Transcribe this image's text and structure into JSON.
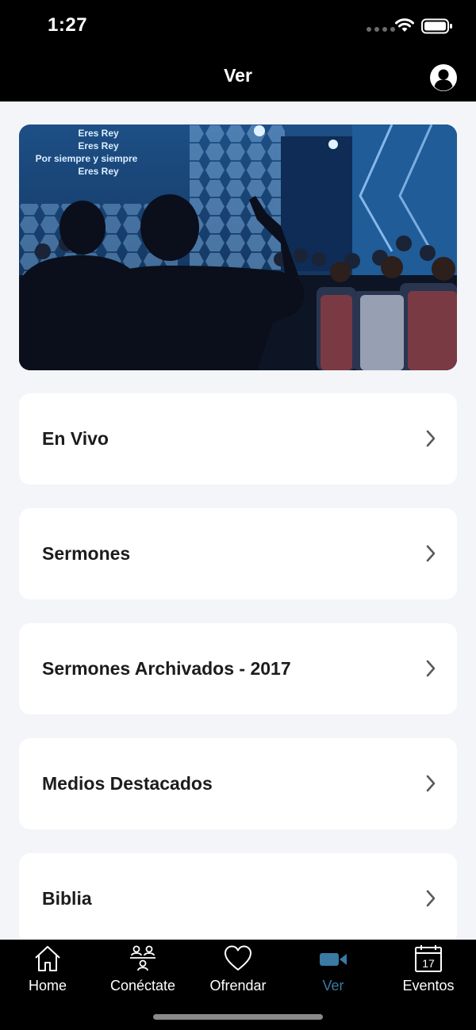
{
  "status_bar": {
    "time": "1:27"
  },
  "header": {
    "title": "Ver"
  },
  "menu": {
    "items": [
      {
        "label": "En Vivo"
      },
      {
        "label": "Sermones"
      },
      {
        "label": "Sermones Archivados - 2017"
      },
      {
        "label": "Medios Destacados"
      },
      {
        "label": "Biblia"
      }
    ]
  },
  "hero": {
    "screen_lines": [
      "Eres Rey",
      "Eres Rey",
      "Por siempre y siempre",
      "Eres Rey"
    ]
  },
  "tab_bar": {
    "active_tab": "Ver",
    "active_color": "#3a7aa5",
    "tabs": [
      {
        "label": "Home",
        "icon": "home-icon"
      },
      {
        "label": "Conéctate",
        "icon": "people-icon"
      },
      {
        "label": "Ofrendar",
        "icon": "heart-icon"
      },
      {
        "label": "Ver",
        "icon": "video-camera-icon"
      },
      {
        "label": "Eventos",
        "icon": "calendar-icon",
        "icon_text": "17"
      }
    ]
  }
}
